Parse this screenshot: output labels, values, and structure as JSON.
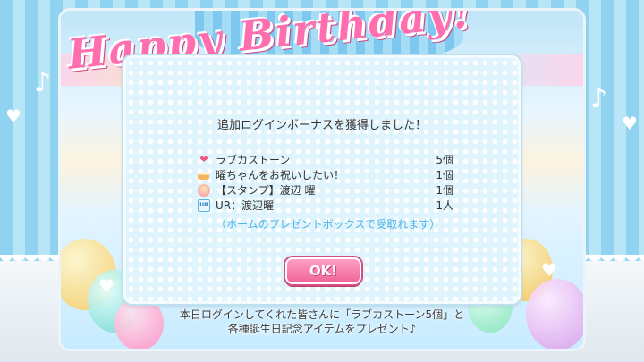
{
  "background": {
    "banner_text": "Happy Birthday!",
    "notes": [
      "♪",
      "♪"
    ]
  },
  "dialog": {
    "title": "追加ログインボーナスを獲得しました！",
    "rewards": [
      {
        "icon": "heart-icon",
        "name": "ラブカストーン",
        "qty": "5個"
      },
      {
        "icon": "cake-icon",
        "name": "曜ちゃんをお祝いしたい！",
        "qty": "1個"
      },
      {
        "icon": "stamp-icon",
        "name": "【スタンプ】渡辺 曜",
        "qty": "1個"
      },
      {
        "icon": "ur-card-icon",
        "name": "UR：渡辺曜",
        "qty": "1人",
        "icon_label": "UR"
      }
    ],
    "note": "（ホームのプレゼントボックスで受取れます）",
    "ok_label": "OK!"
  },
  "footer": {
    "line1": "本日ログインしてくれた皆さんに「ラブカストーン5個」と",
    "line2": "各種誕生日記念アイテムをプレゼント♪"
  },
  "colors": {
    "accent_pink": "#f0659a",
    "note_blue": "#4fb3e8",
    "dialog_bg": "#dff4fc"
  }
}
